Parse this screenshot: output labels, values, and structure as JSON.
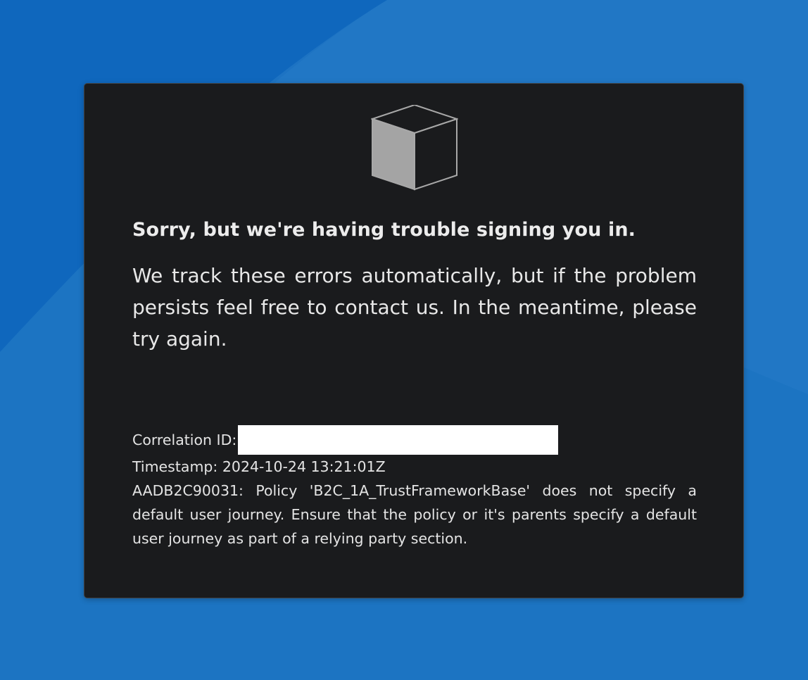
{
  "background": {
    "colors": {
      "base": "#1c74c2",
      "dark_wedge": "#0f67bd",
      "light_wedge": "#2379c6"
    }
  },
  "error_card": {
    "logo_icon": "cube-icon",
    "title": "Sorry, but we're having trouble signing you in.",
    "message": "We track these errors automatically, but if the problem persists feel free to contact us. In the meantime, please try again.",
    "correlation_id_label": "Correlation ID:",
    "timestamp_text": "Timestamp: 2024-10-24 13:21:01Z",
    "error_text": "AADB2C90031: Policy 'B2C_1A_TrustFrameworkBase' does not specify a default user journey. Ensure that the policy or it's parents specify a default user journey as part of a relying party section.",
    "colors": {
      "card_background": "#1a1b1d",
      "text": "#ececec",
      "redaction": "#ffffff"
    }
  }
}
